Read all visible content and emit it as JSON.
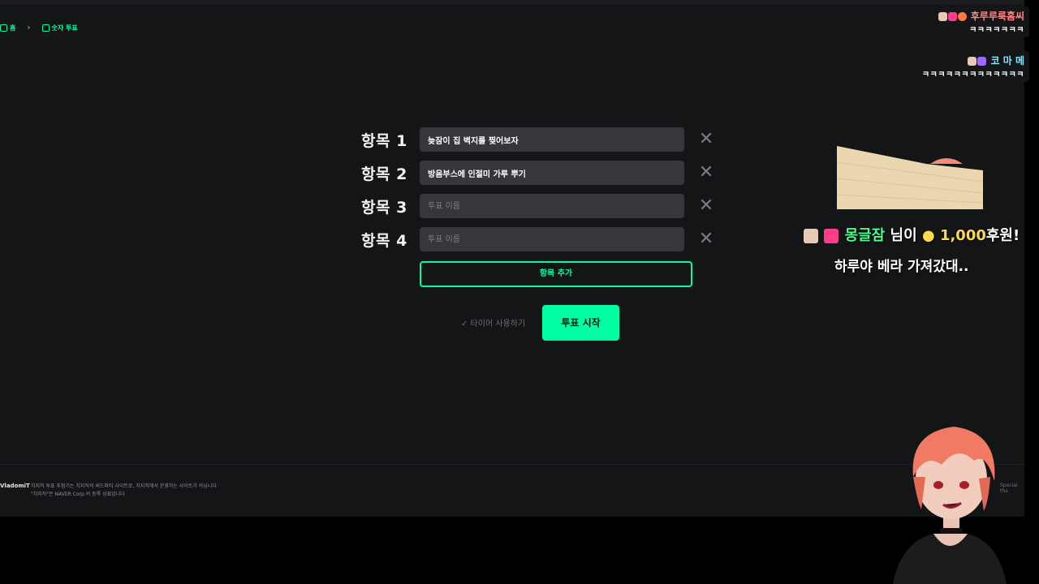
{
  "breadcrumb": {
    "home": "홈",
    "current": "숫자 투표"
  },
  "vote_items": [
    {
      "label": "항목 1",
      "value": "늦잠이 집 벽지를 찢어보자",
      "placeholder": "투표 이름"
    },
    {
      "label": "항목 2",
      "value": "방음부스에 인절미 가루 뿌기",
      "placeholder": "투표 이름"
    },
    {
      "label": "항목 3",
      "value": "",
      "placeholder": "투표 이름"
    },
    {
      "label": "항목 4",
      "value": "",
      "placeholder": "투표 이름"
    }
  ],
  "actions": {
    "add_item": "항목 추가",
    "timer": "✓ 타이머 사용하기",
    "start": "투표 시작"
  },
  "footer": {
    "logo": "VladomiT",
    "line1": "치지직 투표 추첨기는 치지직의 써드파티 사이트로, 치지직에서 운영하는 사이트가 아닙니다",
    "line2": "\"치지직\"은 NAVER Corp.의 등록 상표입니다",
    "right": "Special tha"
  },
  "chat": [
    {
      "nick": "후루루룩홈씨",
      "message": "ㅋㅋㅋㅋㅋㅋㅋ",
      "nick_color": "#ff8a8a"
    },
    {
      "nick": "코 마 메",
      "message": "ㅋㅋㅋㅋㅋㅋㅋㅋㅋㅋㅋㅋㅋ",
      "nick_color": "#7fe9ff"
    }
  ],
  "donation": {
    "name": "몽글잠",
    "suffix": "님이",
    "amount": "1,000",
    "unit": "후원!",
    "message": "하루야 베라 가져갔대.."
  },
  "colors": {
    "accent": "#00ffa3",
    "background": "#141517",
    "input": "#35373b"
  }
}
